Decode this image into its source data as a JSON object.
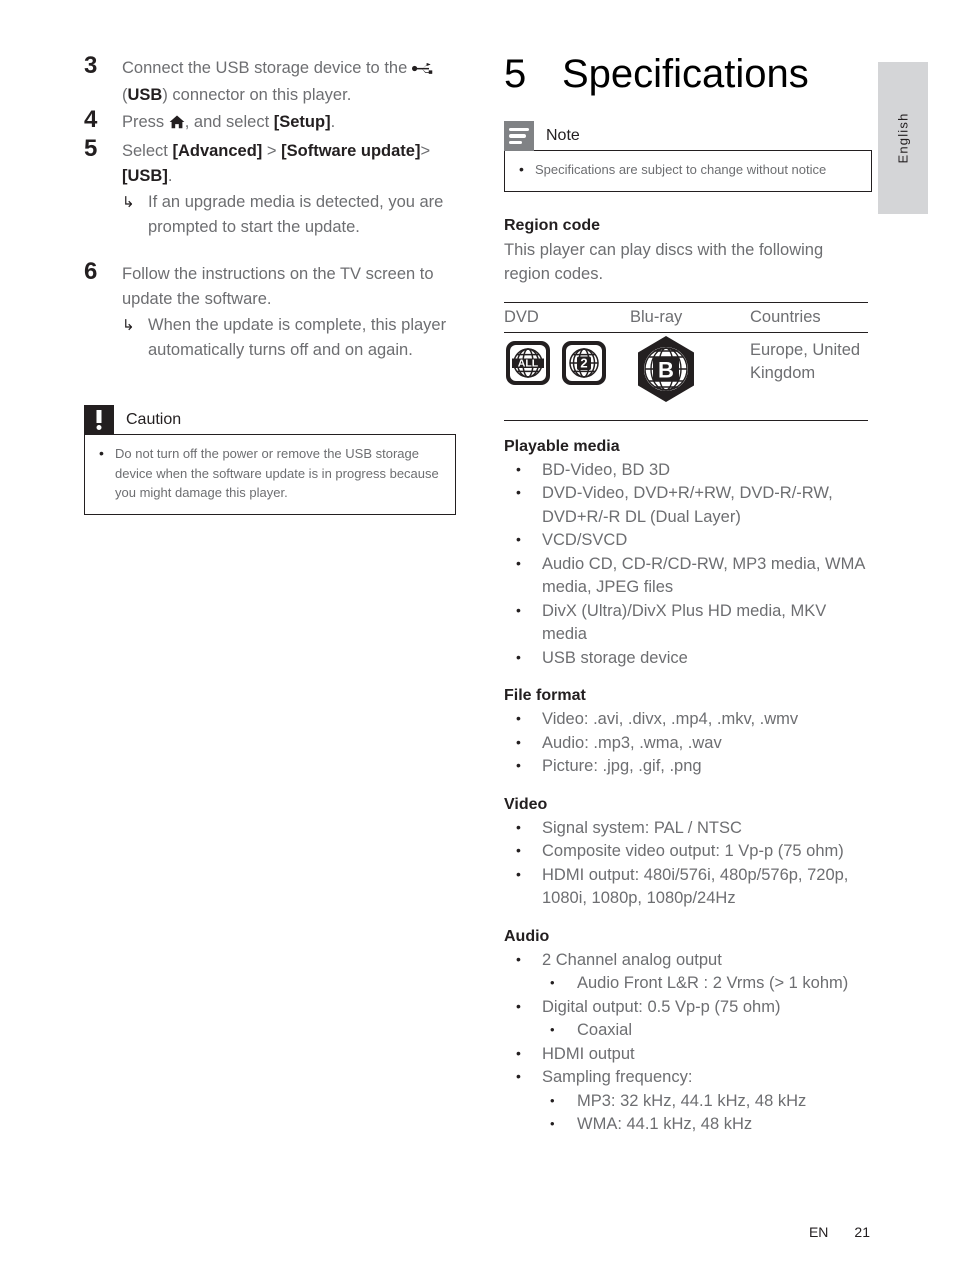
{
  "language_tab": {
    "label": "English"
  },
  "left_column": {
    "steps": [
      {
        "number": "3",
        "text_before_icon": "Connect the USB storage device to the ",
        "icon": "usb-icon",
        "text_after_icon_1": " (",
        "bold_1": "USB",
        "text_after_icon_2": ") connector on this player.",
        "substeps": []
      },
      {
        "number": "4",
        "text_before_icon": "Press ",
        "icon": "home-icon",
        "text_after_icon_1": ", and select ",
        "bold_1": "[Setup]",
        "text_after_icon_2": ".",
        "substeps": []
      },
      {
        "number": "5",
        "plain_1": "Select ",
        "bold_1": "[Advanced]",
        "plain_2": " > ",
        "bold_2": "[Software update]",
        "plain_3": ">",
        "bold_3": "[USB]",
        "plain_4": ".",
        "substeps": [
          "If an upgrade media is detected, you are prompted to start the update."
        ]
      },
      {
        "number": "6",
        "plain_1": "Follow the instructions on the TV screen to update the software.",
        "substeps": [
          "When the update is complete, this player automatically turns off and on again."
        ]
      }
    ],
    "caution": {
      "icon": "exclamation-icon",
      "title": "Caution",
      "items": [
        "Do not turn off the power or remove the USB storage device when the software update is in progress because you might damage this player."
      ]
    }
  },
  "right_column": {
    "chapter": {
      "number": "5",
      "title": "Specifications"
    },
    "note": {
      "icon": "note-lines-icon",
      "title": "Note",
      "items": [
        "Specifications are subject to change without notice"
      ]
    },
    "region_code": {
      "heading": "Region code",
      "paragraph": "This player can play discs with the following region codes.",
      "table": {
        "headers": [
          "DVD",
          "Blu-ray",
          "Countries"
        ],
        "row": {
          "dvd_icons": [
            "ALL",
            "2"
          ],
          "bluray_icon": "B",
          "countries": "Europe, United Kingdom"
        }
      }
    },
    "sections": [
      {
        "heading": "Playable media",
        "items": [
          "BD-Video, BD 3D",
          "DVD-Video, DVD+R/+RW, DVD-R/-RW, DVD+R/-R DL (Dual Layer)",
          "VCD/SVCD",
          "Audio CD, CD-R/CD-RW, MP3 media, WMA media, JPEG files",
          "DivX (Ultra)/DivX Plus HD media, MKV media",
          "USB storage device"
        ]
      },
      {
        "heading": "File format",
        "items": [
          "Video: .avi, .divx, .mp4, .mkv, .wmv",
          "Audio: .mp3, .wma, .wav",
          "Picture: .jpg, .gif, .png"
        ]
      },
      {
        "heading": "Video",
        "items": [
          "Signal system: PAL / NTSC",
          "Composite video output: 1 Vp-p (75 ohm)",
          "HDMI output: 480i/576i, 480p/576p, 720p, 1080i, 1080p, 1080p/24Hz"
        ]
      },
      {
        "heading": "Audio",
        "items": [
          "2 Channel analog output",
          "Digital output: 0.5 Vp-p (75 ohm)",
          "HDMI output",
          "Sampling frequency:"
        ],
        "subitems": {
          "0": [
            "Audio Front L&R : 2 Vrms (> 1 kohm)"
          ],
          "1": [
            "Coaxial"
          ],
          "3": [
            "MP3: 32 kHz, 44.1 kHz, 48 kHz",
            "WMA: 44.1 kHz, 48 kHz"
          ]
        }
      }
    ]
  },
  "footer": {
    "lang_code": "EN",
    "page_number": "21"
  },
  "colors": {
    "body_text": "#6d6e71",
    "heading_text": "#231f20",
    "note_badge": "#808285",
    "caution_badge": "#231f20",
    "lang_tab_bg": "#d4d5d7"
  }
}
